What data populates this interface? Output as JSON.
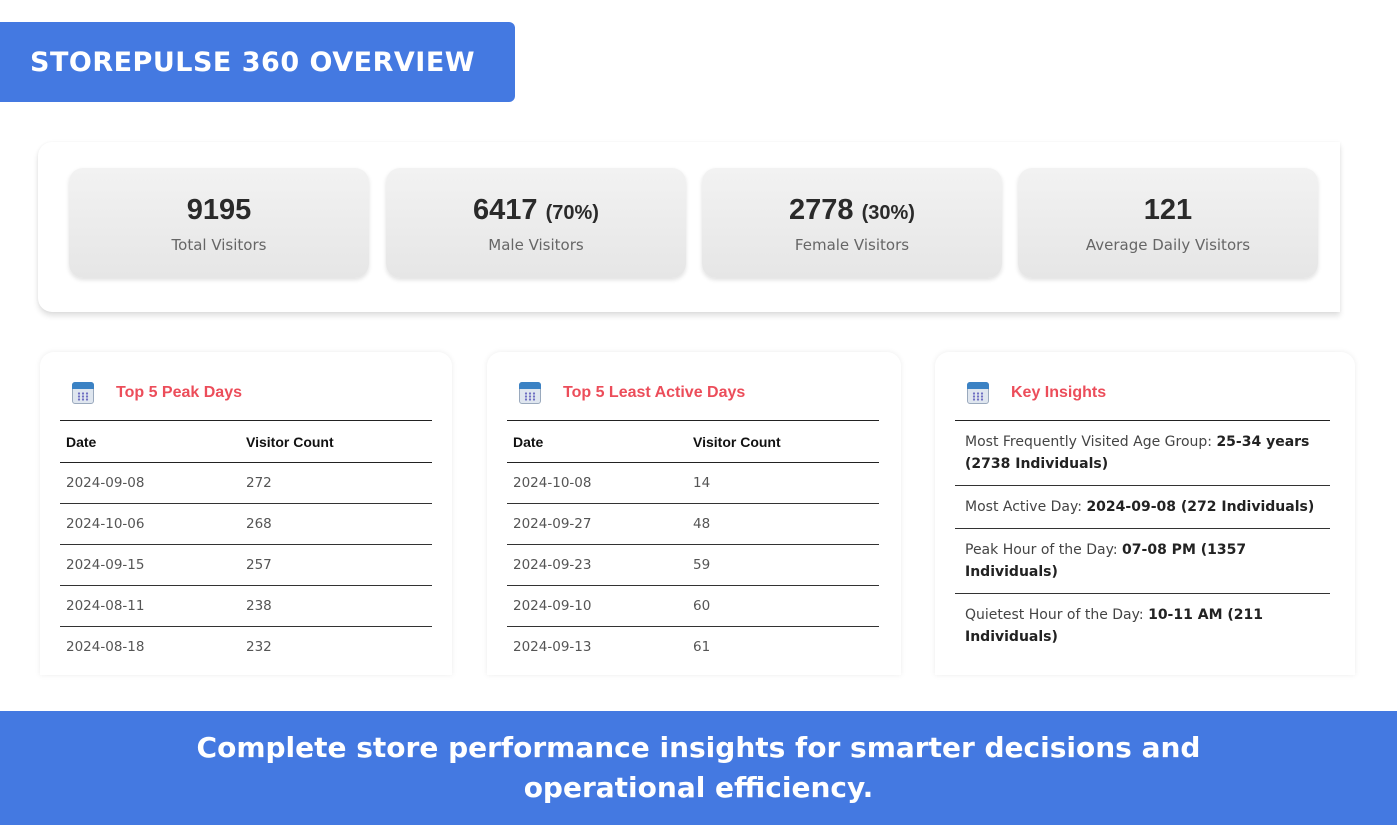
{
  "banner": {
    "title": "STOREPULSE 360 OVERVIEW"
  },
  "stats": [
    {
      "value": "9195",
      "pct": "",
      "label": "Total Visitors"
    },
    {
      "value": "6417",
      "pct": "(70%)",
      "label": "Male Visitors"
    },
    {
      "value": "2778",
      "pct": "(30%)",
      "label": "Female Visitors"
    },
    {
      "value": "121",
      "pct": "",
      "label": "Average Daily Visitors"
    }
  ],
  "peak_days": {
    "title": "Top 5 Peak Days",
    "icon": "calendar-icon",
    "headers": [
      "Date",
      "Visitor Count"
    ],
    "rows": [
      [
        "2024-09-08",
        "272"
      ],
      [
        "2024-10-06",
        "268"
      ],
      [
        "2024-09-15",
        "257"
      ],
      [
        "2024-08-11",
        "238"
      ],
      [
        "2024-08-18",
        "232"
      ]
    ]
  },
  "least_days": {
    "title": "Top 5 Least Active Days",
    "icon": "calendar-icon",
    "headers": [
      "Date",
      "Visitor Count"
    ],
    "rows": [
      [
        "2024-10-08",
        "14"
      ],
      [
        "2024-09-27",
        "48"
      ],
      [
        "2024-09-23",
        "59"
      ],
      [
        "2024-09-10",
        "60"
      ],
      [
        "2024-09-13",
        "61"
      ]
    ]
  },
  "insights": {
    "title": "Key Insights",
    "icon": "calendar-icon",
    "items": [
      {
        "label": "Most Frequently Visited Age Group: ",
        "value": "25-34 years (2738 Individuals)"
      },
      {
        "label": "Most Active Day: ",
        "value": "2024-09-08 (272 Individuals)"
      },
      {
        "label": "Peak Hour of the Day: ",
        "value": "07-08 PM (1357 Individuals)"
      },
      {
        "label": "Quietest Hour of the Day: ",
        "value": "10-11 AM (211 Individuals)"
      }
    ]
  },
  "footer": {
    "text": "Complete store performance insights for smarter decisions and operational efficiency."
  },
  "colors": {
    "accent": "#4479e1",
    "title_red": "#ec4d5a"
  }
}
